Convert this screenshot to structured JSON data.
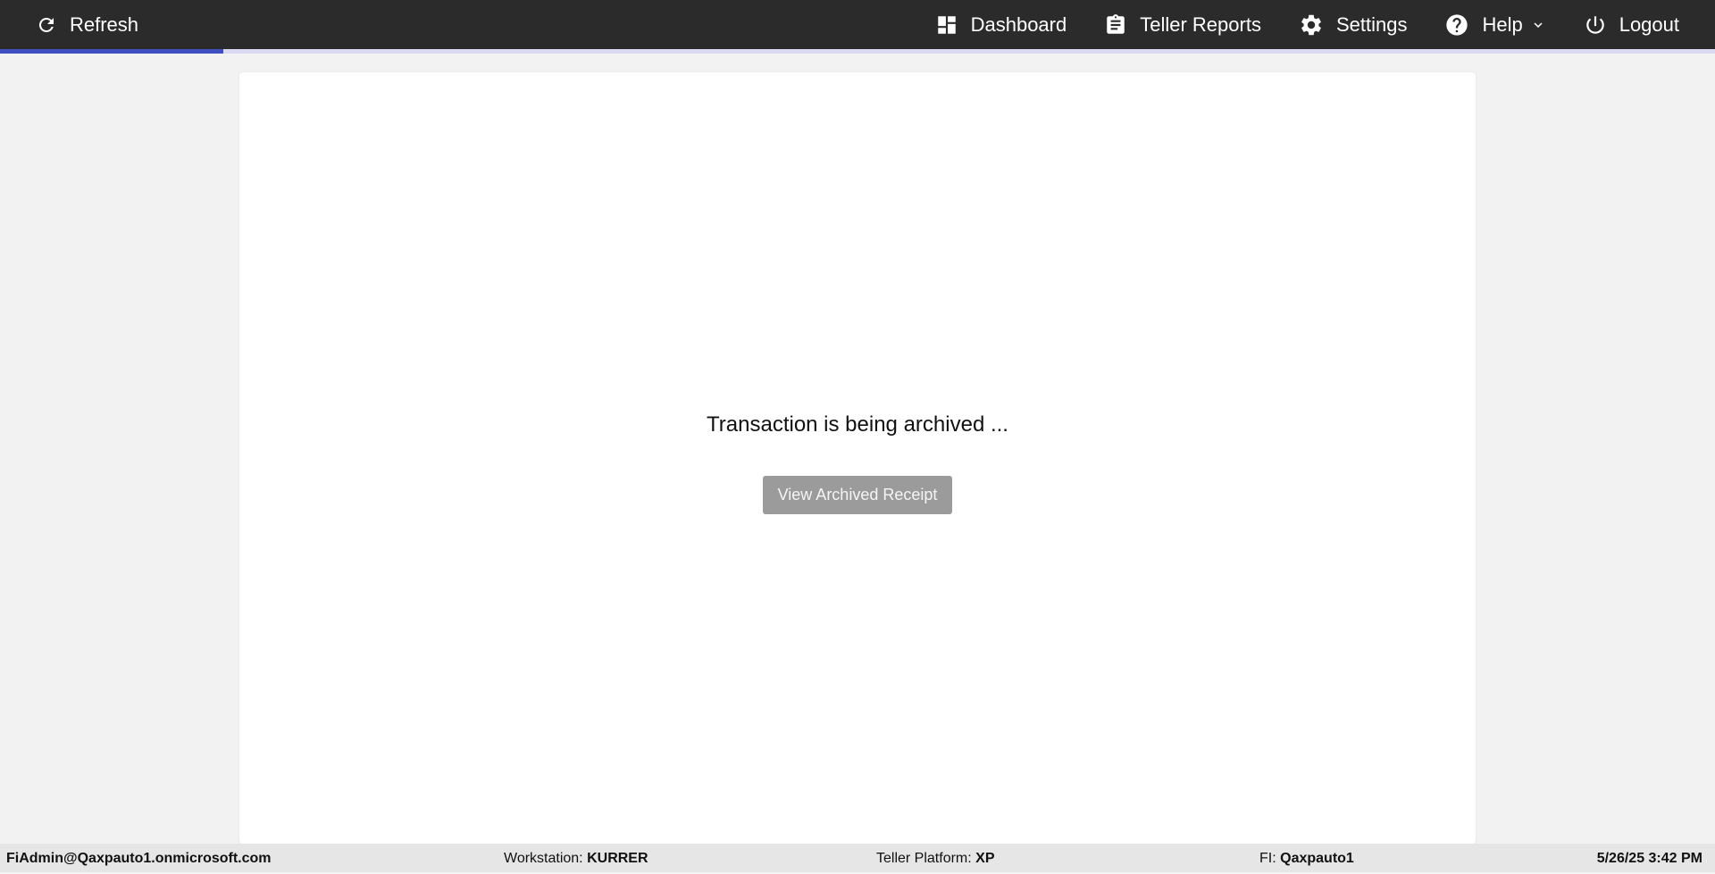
{
  "nav": {
    "refresh_label": "Refresh",
    "items": [
      {
        "label": "Dashboard",
        "icon": "dashboard-icon"
      },
      {
        "label": "Teller Reports",
        "icon": "clipboard-icon"
      },
      {
        "label": "Settings",
        "icon": "gear-icon"
      },
      {
        "label": "Help",
        "icon": "help-circle-icon"
      },
      {
        "label": "Logout",
        "icon": "power-icon"
      }
    ],
    "progress_fraction": 0.13
  },
  "main": {
    "status_message": "Transaction is being archived ...",
    "view_receipt_label": "View Archived Receipt"
  },
  "footer": {
    "user": "FiAdmin@Qaxpauto1.onmicrosoft.com",
    "workstation_label": "Workstation:",
    "workstation_value": "KURRER",
    "platform_label": "Teller Platform:",
    "platform_value": "XP",
    "fi_label": "FI:",
    "fi_value": "Qaxpauto1",
    "datetime": "5/26/25 3:42 PM"
  },
  "colors": {
    "nav_bg": "#2b2b2b",
    "progress_fill": "#3f4fbf",
    "progress_track": "#d9daf1",
    "page_bg": "#f2f2f2",
    "button_bg": "#9b9b9b"
  }
}
